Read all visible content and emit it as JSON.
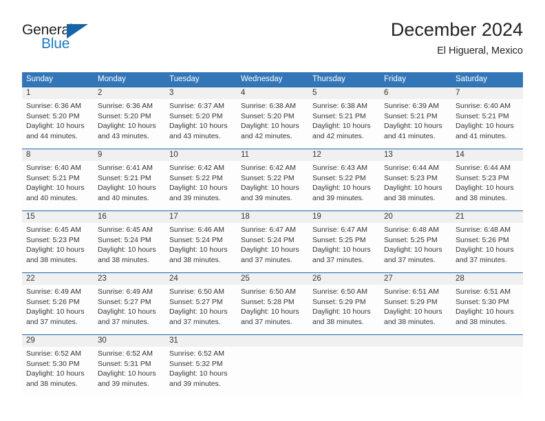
{
  "brand": {
    "name_top": "General",
    "name_bottom": "Blue",
    "triangle_icon": "blue-triangle-icon",
    "accent_color": "#1c7ac0",
    "logo_dark_color": "#231f20"
  },
  "header": {
    "title": "December 2024",
    "subtitle": "El Higueral, Mexico",
    "header_bg_color": "#3276b8",
    "rule_color": "#1d66aa",
    "daynum_bg_color": "#f0f0f0"
  },
  "weekdays": [
    "Sunday",
    "Monday",
    "Tuesday",
    "Wednesday",
    "Thursday",
    "Friday",
    "Saturday"
  ],
  "weeks": [
    [
      {
        "day": "1",
        "sunrise": "Sunrise: 6:36 AM",
        "sunset": "Sunset: 5:20 PM",
        "daylight1": "Daylight: 10 hours",
        "daylight2": "and 44 minutes."
      },
      {
        "day": "2",
        "sunrise": "Sunrise: 6:36 AM",
        "sunset": "Sunset: 5:20 PM",
        "daylight1": "Daylight: 10 hours",
        "daylight2": "and 43 minutes."
      },
      {
        "day": "3",
        "sunrise": "Sunrise: 6:37 AM",
        "sunset": "Sunset: 5:20 PM",
        "daylight1": "Daylight: 10 hours",
        "daylight2": "and 43 minutes."
      },
      {
        "day": "4",
        "sunrise": "Sunrise: 6:38 AM",
        "sunset": "Sunset: 5:20 PM",
        "daylight1": "Daylight: 10 hours",
        "daylight2": "and 42 minutes."
      },
      {
        "day": "5",
        "sunrise": "Sunrise: 6:38 AM",
        "sunset": "Sunset: 5:21 PM",
        "daylight1": "Daylight: 10 hours",
        "daylight2": "and 42 minutes."
      },
      {
        "day": "6",
        "sunrise": "Sunrise: 6:39 AM",
        "sunset": "Sunset: 5:21 PM",
        "daylight1": "Daylight: 10 hours",
        "daylight2": "and 41 minutes."
      },
      {
        "day": "7",
        "sunrise": "Sunrise: 6:40 AM",
        "sunset": "Sunset: 5:21 PM",
        "daylight1": "Daylight: 10 hours",
        "daylight2": "and 41 minutes."
      }
    ],
    [
      {
        "day": "8",
        "sunrise": "Sunrise: 6:40 AM",
        "sunset": "Sunset: 5:21 PM",
        "daylight1": "Daylight: 10 hours",
        "daylight2": "and 40 minutes."
      },
      {
        "day": "9",
        "sunrise": "Sunrise: 6:41 AM",
        "sunset": "Sunset: 5:21 PM",
        "daylight1": "Daylight: 10 hours",
        "daylight2": "and 40 minutes."
      },
      {
        "day": "10",
        "sunrise": "Sunrise: 6:42 AM",
        "sunset": "Sunset: 5:22 PM",
        "daylight1": "Daylight: 10 hours",
        "daylight2": "and 39 minutes."
      },
      {
        "day": "11",
        "sunrise": "Sunrise: 6:42 AM",
        "sunset": "Sunset: 5:22 PM",
        "daylight1": "Daylight: 10 hours",
        "daylight2": "and 39 minutes."
      },
      {
        "day": "12",
        "sunrise": "Sunrise: 6:43 AM",
        "sunset": "Sunset: 5:22 PM",
        "daylight1": "Daylight: 10 hours",
        "daylight2": "and 39 minutes."
      },
      {
        "day": "13",
        "sunrise": "Sunrise: 6:44 AM",
        "sunset": "Sunset: 5:23 PM",
        "daylight1": "Daylight: 10 hours",
        "daylight2": "and 38 minutes."
      },
      {
        "day": "14",
        "sunrise": "Sunrise: 6:44 AM",
        "sunset": "Sunset: 5:23 PM",
        "daylight1": "Daylight: 10 hours",
        "daylight2": "and 38 minutes."
      }
    ],
    [
      {
        "day": "15",
        "sunrise": "Sunrise: 6:45 AM",
        "sunset": "Sunset: 5:23 PM",
        "daylight1": "Daylight: 10 hours",
        "daylight2": "and 38 minutes."
      },
      {
        "day": "16",
        "sunrise": "Sunrise: 6:45 AM",
        "sunset": "Sunset: 5:24 PM",
        "daylight1": "Daylight: 10 hours",
        "daylight2": "and 38 minutes."
      },
      {
        "day": "17",
        "sunrise": "Sunrise: 6:46 AM",
        "sunset": "Sunset: 5:24 PM",
        "daylight1": "Daylight: 10 hours",
        "daylight2": "and 38 minutes."
      },
      {
        "day": "18",
        "sunrise": "Sunrise: 6:47 AM",
        "sunset": "Sunset: 5:24 PM",
        "daylight1": "Daylight: 10 hours",
        "daylight2": "and 37 minutes."
      },
      {
        "day": "19",
        "sunrise": "Sunrise: 6:47 AM",
        "sunset": "Sunset: 5:25 PM",
        "daylight1": "Daylight: 10 hours",
        "daylight2": "and 37 minutes."
      },
      {
        "day": "20",
        "sunrise": "Sunrise: 6:48 AM",
        "sunset": "Sunset: 5:25 PM",
        "daylight1": "Daylight: 10 hours",
        "daylight2": "and 37 minutes."
      },
      {
        "day": "21",
        "sunrise": "Sunrise: 6:48 AM",
        "sunset": "Sunset: 5:26 PM",
        "daylight1": "Daylight: 10 hours",
        "daylight2": "and 37 minutes."
      }
    ],
    [
      {
        "day": "22",
        "sunrise": "Sunrise: 6:49 AM",
        "sunset": "Sunset: 5:26 PM",
        "daylight1": "Daylight: 10 hours",
        "daylight2": "and 37 minutes."
      },
      {
        "day": "23",
        "sunrise": "Sunrise: 6:49 AM",
        "sunset": "Sunset: 5:27 PM",
        "daylight1": "Daylight: 10 hours",
        "daylight2": "and 37 minutes."
      },
      {
        "day": "24",
        "sunrise": "Sunrise: 6:50 AM",
        "sunset": "Sunset: 5:27 PM",
        "daylight1": "Daylight: 10 hours",
        "daylight2": "and 37 minutes."
      },
      {
        "day": "25",
        "sunrise": "Sunrise: 6:50 AM",
        "sunset": "Sunset: 5:28 PM",
        "daylight1": "Daylight: 10 hours",
        "daylight2": "and 37 minutes."
      },
      {
        "day": "26",
        "sunrise": "Sunrise: 6:50 AM",
        "sunset": "Sunset: 5:29 PM",
        "daylight1": "Daylight: 10 hours",
        "daylight2": "and 38 minutes."
      },
      {
        "day": "27",
        "sunrise": "Sunrise: 6:51 AM",
        "sunset": "Sunset: 5:29 PM",
        "daylight1": "Daylight: 10 hours",
        "daylight2": "and 38 minutes."
      },
      {
        "day": "28",
        "sunrise": "Sunrise: 6:51 AM",
        "sunset": "Sunset: 5:30 PM",
        "daylight1": "Daylight: 10 hours",
        "daylight2": "and 38 minutes."
      }
    ],
    [
      {
        "day": "29",
        "sunrise": "Sunrise: 6:52 AM",
        "sunset": "Sunset: 5:30 PM",
        "daylight1": "Daylight: 10 hours",
        "daylight2": "and 38 minutes."
      },
      {
        "day": "30",
        "sunrise": "Sunrise: 6:52 AM",
        "sunset": "Sunset: 5:31 PM",
        "daylight1": "Daylight: 10 hours",
        "daylight2": "and 39 minutes."
      },
      {
        "day": "31",
        "sunrise": "Sunrise: 6:52 AM",
        "sunset": "Sunset: 5:32 PM",
        "daylight1": "Daylight: 10 hours",
        "daylight2": "and 39 minutes."
      },
      {
        "day": "",
        "sunrise": "",
        "sunset": "",
        "daylight1": "",
        "daylight2": ""
      },
      {
        "day": "",
        "sunrise": "",
        "sunset": "",
        "daylight1": "",
        "daylight2": ""
      },
      {
        "day": "",
        "sunrise": "",
        "sunset": "",
        "daylight1": "",
        "daylight2": ""
      },
      {
        "day": "",
        "sunrise": "",
        "sunset": "",
        "daylight1": "",
        "daylight2": ""
      }
    ]
  ]
}
